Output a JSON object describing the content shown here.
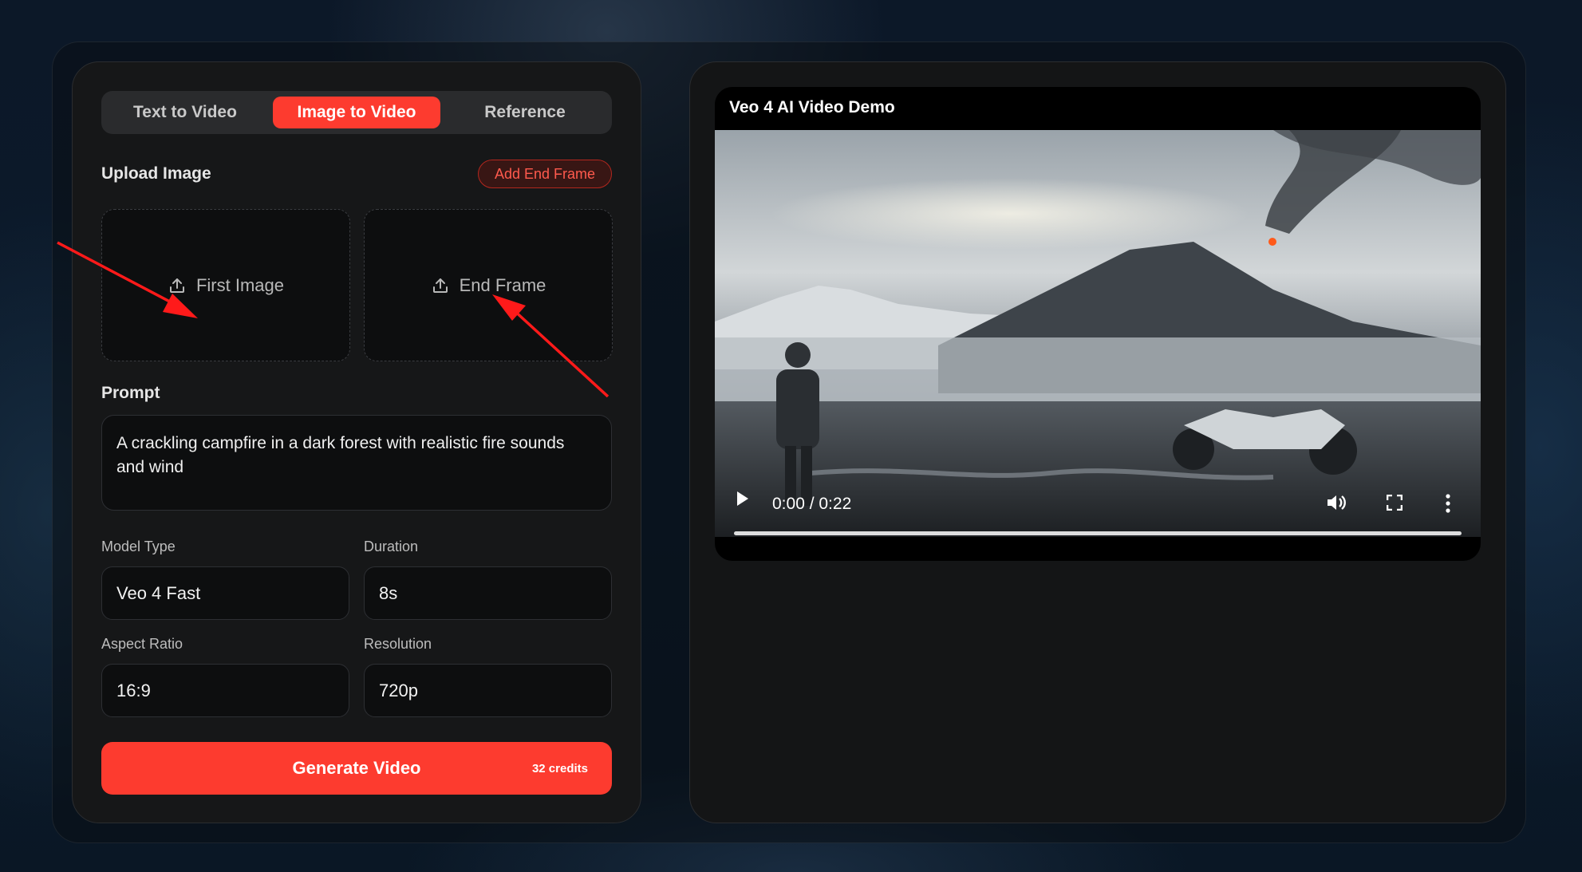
{
  "tabs": [
    {
      "label": "Text to Video",
      "active": false
    },
    {
      "label": "Image to Video",
      "active": true
    },
    {
      "label": "Reference",
      "active": false
    }
  ],
  "upload": {
    "title": "Upload Image",
    "add_end_frame_label": "Add End Frame",
    "first_image_label": "First Image",
    "end_frame_label": "End Frame"
  },
  "prompt": {
    "title": "Prompt",
    "value": "A crackling campfire in a dark forest with realistic fire sounds and wind"
  },
  "settings": {
    "model_type": {
      "label": "Model Type",
      "value": "Veo 4 Fast"
    },
    "duration": {
      "label": "Duration",
      "value": "8s"
    },
    "aspect_ratio": {
      "label": "Aspect Ratio",
      "value": "16:9"
    },
    "resolution": {
      "label": "Resolution",
      "value": "720p"
    }
  },
  "generate": {
    "label": "Generate Video",
    "credits": "32 credits"
  },
  "video": {
    "title": "Veo 4 AI Video Demo",
    "time": "0:00 / 0:22",
    "progress": 0
  },
  "colors": {
    "accent": "#fd3b2f",
    "annotation_arrow": "#ff1a1a"
  },
  "icons": {
    "upload": "upload-icon",
    "play": "play-icon",
    "volume": "volume-icon",
    "fullscreen": "fullscreen-icon",
    "more": "more-vertical-icon"
  }
}
